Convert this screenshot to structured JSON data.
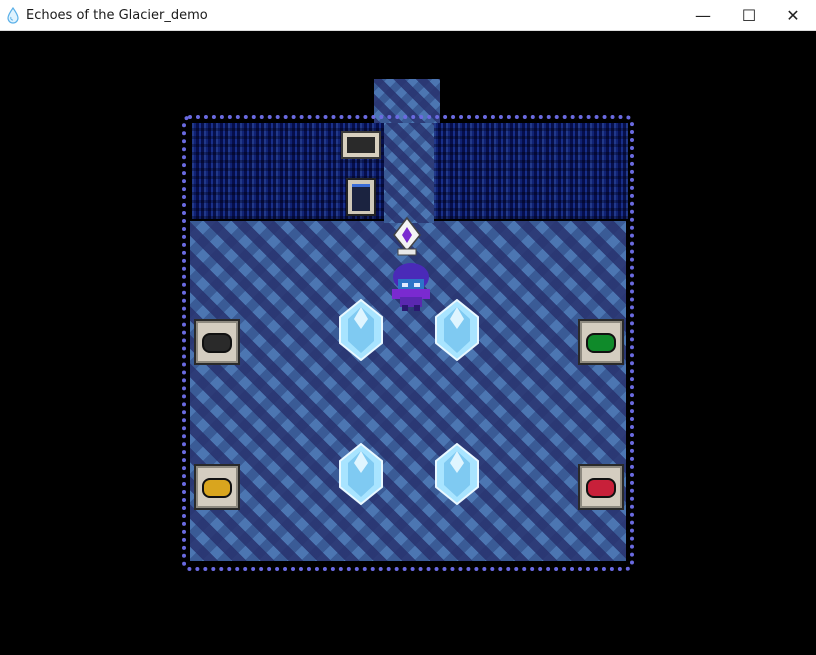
{
  "window": {
    "title": "Echoes of the Glacier_demo",
    "min_glyph": "—",
    "max_glyph": "☐",
    "close_glyph": "✕",
    "app_icon": "droplet-icon"
  },
  "game": {
    "room": "ice-puzzle-room",
    "colors": {
      "floor": "#3a5b96",
      "wall": "#2b3f8a",
      "crystal": "#a8e4ff",
      "switch_black": "#2a2a2a",
      "switch_green": "#0f8a2a",
      "switch_yellow": "#d9a51e",
      "switch_red": "#c8203a"
    },
    "switches": [
      {
        "id": "black",
        "color": "#2a2a2a"
      },
      {
        "id": "green",
        "color": "#0f8a2a"
      },
      {
        "id": "yellow",
        "color": "#d9a51e"
      },
      {
        "id": "red",
        "color": "#c8203a"
      }
    ],
    "crystals": [
      {
        "id": "crystal-1"
      },
      {
        "id": "crystal-2"
      },
      {
        "id": "crystal-3"
      },
      {
        "id": "crystal-4"
      }
    ]
  }
}
